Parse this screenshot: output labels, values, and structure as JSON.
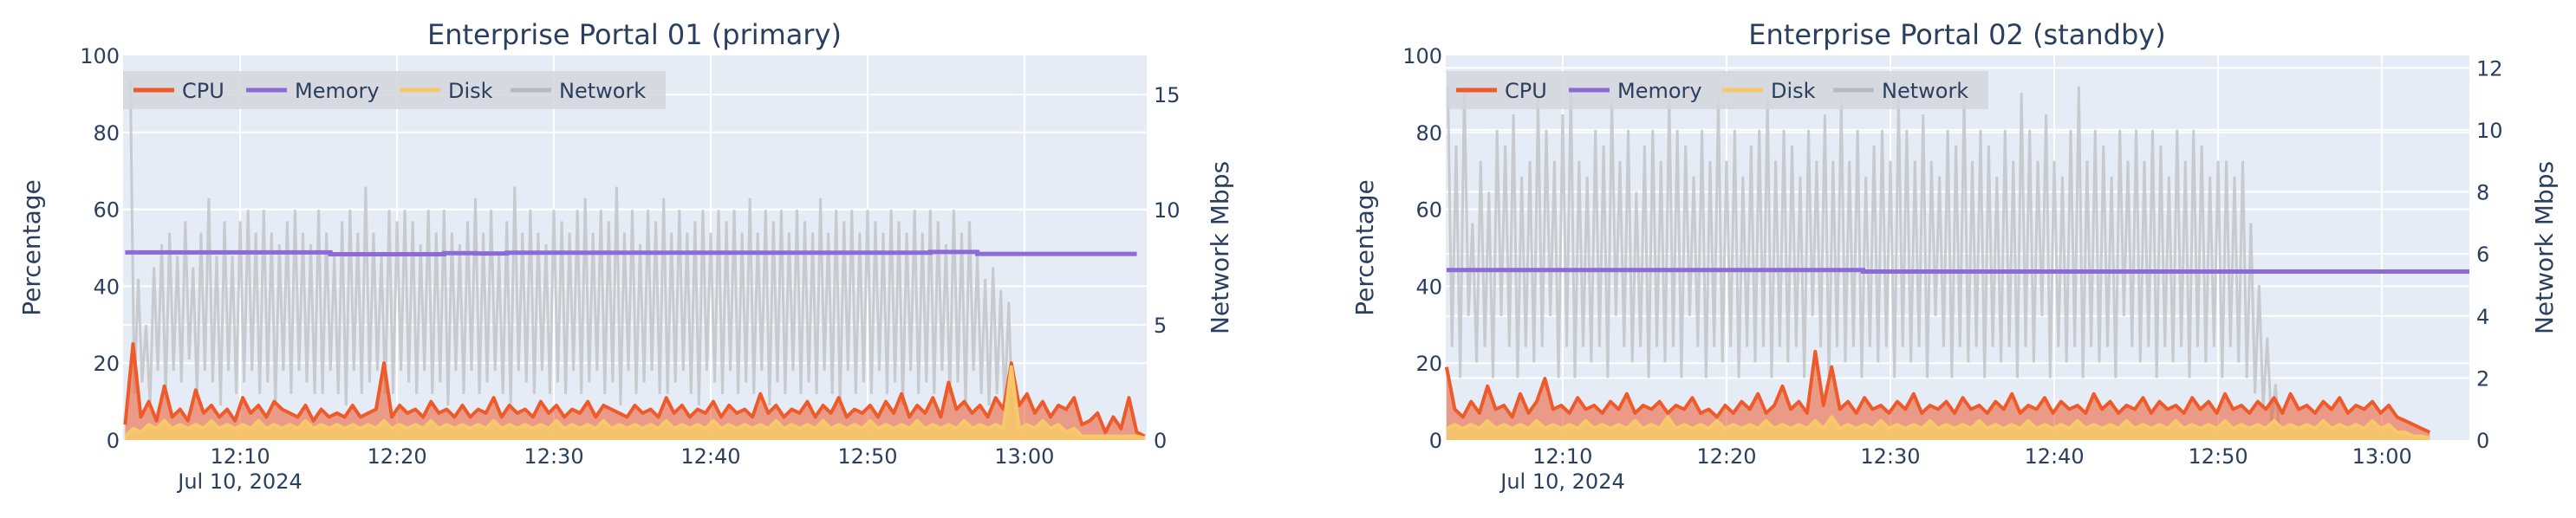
{
  "chart_data": [
    {
      "type": "line",
      "title": "Enterprise Portal 01 (primary)",
      "xlabel": "",
      "ylabel": "Percentage",
      "y2label": "Network Mbps",
      "date_label": "Jul 10, 2024",
      "x_range": [
        "12:02:32",
        "13:07:48"
      ],
      "x_ticks": [
        "12:10",
        "12:20",
        "12:30",
        "12:40",
        "12:50",
        "13:00"
      ],
      "ylim": [
        0,
        100
      ],
      "y_ticks": [
        0,
        20,
        40,
        60,
        80,
        100
      ],
      "y2lim": [
        0,
        16.7
      ],
      "y2_ticks": [
        0,
        5,
        10,
        15
      ],
      "grid": true,
      "legend": {
        "placement": "top-left",
        "orientation": "horizontal"
      },
      "series": [
        {
          "name": "CPU",
          "color": "#ef5a2b",
          "axis": "y",
          "fill": true,
          "start": "12:02:40",
          "step_seconds": 30,
          "values": [
            4,
            25,
            6,
            10,
            5,
            14,
            6,
            8,
            5,
            13,
            7,
            9,
            6,
            8,
            5,
            11,
            7,
            9,
            6,
            10,
            8,
            7,
            6,
            9,
            5,
            8,
            6,
            7,
            6,
            9,
            6,
            7,
            8,
            20,
            6,
            9,
            7,
            8,
            6,
            10,
            7,
            8,
            6,
            9,
            6,
            8,
            7,
            11,
            6,
            9,
            7,
            8,
            6,
            10,
            7,
            9,
            6,
            8,
            7,
            10,
            6,
            9,
            8,
            7,
            6,
            9,
            7,
            8,
            6,
            11,
            7,
            9,
            6,
            8,
            7,
            10,
            6,
            9,
            7,
            8,
            6,
            12,
            7,
            9,
            6,
            8,
            7,
            10,
            6,
            9,
            7,
            11,
            6,
            8,
            7,
            9,
            6,
            10,
            7,
            12,
            6,
            9,
            7,
            11,
            6,
            15,
            8,
            10,
            7,
            9,
            6,
            11,
            8,
            20,
            9,
            12,
            7,
            10,
            6,
            9,
            8,
            11,
            4,
            5,
            7,
            2,
            6,
            3,
            11,
            2,
            1
          ]
        },
        {
          "name": "Memory",
          "color": "#8c6bd8",
          "axis": "y",
          "fill": false,
          "steps": [
            [
              "12:02:40",
              48.8
            ],
            [
              "12:15:45",
              48.3
            ],
            [
              "12:23:00",
              48.6
            ],
            [
              "12:25:00",
              48.5
            ],
            [
              "12:27:00",
              48.7
            ],
            [
              "12:54:00",
              48.9
            ],
            [
              "12:57:00",
              48.4
            ],
            [
              "13:07:10",
              48.4
            ]
          ]
        },
        {
          "name": "Disk",
          "color": "#f7c96a",
          "axis": "y",
          "fill": true,
          "start": "12:02:40",
          "step_seconds": 30,
          "values": [
            1,
            3,
            2,
            4,
            3,
            5,
            3,
            4,
            3,
            4,
            3,
            5,
            3,
            4,
            3,
            4,
            3,
            5,
            3,
            4,
            3,
            4,
            3,
            5,
            3,
            4,
            3,
            4,
            3,
            4,
            3,
            4,
            3,
            5,
            3,
            4,
            3,
            4,
            3,
            5,
            3,
            4,
            3,
            4,
            3,
            4,
            3,
            5,
            3,
            4,
            3,
            4,
            3,
            4,
            3,
            5,
            3,
            4,
            3,
            4,
            3,
            5,
            3,
            4,
            3,
            4,
            3,
            4,
            3,
            5,
            3,
            4,
            3,
            4,
            3,
            5,
            3,
            4,
            3,
            4,
            3,
            4,
            3,
            5,
            3,
            4,
            3,
            4,
            3,
            5,
            3,
            4,
            3,
            4,
            3,
            5,
            3,
            4,
            3,
            4,
            3,
            5,
            3,
            4,
            3,
            4,
            3,
            5,
            3,
            4,
            3,
            4,
            3,
            19,
            3,
            4,
            3,
            5,
            3,
            4,
            2,
            3,
            1,
            1,
            1,
            1,
            1,
            1,
            1,
            1,
            0.5
          ]
        },
        {
          "name": "Network",
          "color": "#c4c6ca",
          "axis": "y2",
          "fill": false,
          "start": "12:03:00",
          "step_seconds": 15,
          "values": [
            15.6,
            2,
            7,
            2.5,
            5,
            1.5,
            7.5,
            3,
            8.5,
            2,
            9,
            3,
            8,
            2.5,
            9.5,
            3.5,
            7.5,
            2,
            9,
            3,
            10.5,
            2.5,
            8,
            1.5,
            9.5,
            3,
            8,
            2,
            9.5,
            2.5,
            10,
            3,
            9,
            2,
            10,
            2.5,
            9,
            1.5,
            8.5,
            3,
            9.5,
            2,
            10,
            3,
            9,
            2.5,
            8.5,
            2,
            10,
            2,
            9,
            3,
            8,
            2,
            9.5,
            1.5,
            10,
            3,
            9,
            2,
            11,
            2.5,
            9,
            3,
            8,
            2,
            10,
            2,
            9.5,
            3,
            10,
            2.5,
            9.5,
            2,
            8.5,
            3,
            10,
            2,
            9,
            2.5,
            10,
            1.5,
            9,
            3,
            8.5,
            2,
            9.5,
            3,
            10.5,
            2,
            9,
            2.5,
            10,
            3,
            8,
            2,
            9.5,
            1.5,
            11,
            3,
            9,
            2.5,
            10,
            2,
            9,
            3,
            8.5,
            2,
            10,
            2.5,
            9.5,
            2,
            9,
            3,
            10,
            2,
            10.5,
            2.5,
            9,
            3,
            10,
            2,
            9.5,
            2.5,
            11,
            1.5,
            9,
            3,
            10,
            2,
            8.5,
            2.5,
            10,
            3,
            9.5,
            2,
            10.5,
            2,
            9,
            2.5,
            10,
            3,
            9,
            2,
            9.5,
            1.5,
            10,
            3,
            9,
            2.5,
            10,
            2,
            9.5,
            3,
            10,
            2,
            9,
            2.5,
            10.5,
            2,
            9,
            3,
            10,
            1.5,
            9.5,
            2.5,
            10,
            2,
            9,
            3,
            10,
            2,
            9.5,
            2.5,
            9,
            2,
            10.5,
            3,
            9,
            2,
            10,
            1.5,
            9.5,
            3,
            10,
            2,
            9,
            2.5,
            10,
            2,
            9.5,
            3,
            9,
            2,
            10,
            2.5,
            9.5,
            1.5,
            9,
            3,
            10,
            2,
            9,
            2.5,
            10,
            2,
            9.5,
            3,
            8.5,
            2,
            10,
            2.5,
            9,
            1.5,
            9.5,
            3,
            8,
            2,
            7,
            1.5,
            7.5,
            2,
            6.5,
            1.5,
            6,
            0.5
          ]
        }
      ]
    },
    {
      "type": "line",
      "title": "Enterprise Portal 02 (standby)",
      "xlabel": "",
      "ylabel": "Percentage",
      "y2label": "Network Mbps",
      "date_label": "Jul 10, 2024",
      "x_range": [
        "12:02:52",
        "13:05:20"
      ],
      "x_ticks": [
        "12:10",
        "12:20",
        "12:30",
        "12:40",
        "12:50",
        "13:00"
      ],
      "ylim": [
        0,
        100
      ],
      "y_ticks": [
        0,
        20,
        40,
        60,
        80,
        100
      ],
      "y2lim": [
        0,
        12.4
      ],
      "y2_ticks": [
        0,
        2,
        4,
        6,
        8,
        10,
        12
      ],
      "grid": true,
      "legend": {
        "placement": "top-left",
        "orientation": "horizontal"
      },
      "series": [
        {
          "name": "CPU",
          "color": "#ef5a2b",
          "axis": "y",
          "fill": true,
          "start": "12:02:55",
          "step_seconds": 30,
          "values": [
            19,
            8,
            6,
            10,
            7,
            14,
            8,
            9,
            6,
            12,
            7,
            10,
            16,
            8,
            9,
            7,
            11,
            8,
            9,
            7,
            10,
            8,
            12,
            7,
            9,
            8,
            10,
            7,
            9,
            8,
            11,
            7,
            8,
            6,
            9,
            7,
            10,
            8,
            12,
            7,
            9,
            14,
            8,
            10,
            7,
            23,
            9,
            19,
            8,
            10,
            7,
            11,
            8,
            9,
            7,
            10,
            8,
            12,
            7,
            9,
            8,
            10,
            7,
            11,
            8,
            9,
            7,
            10,
            8,
            12,
            7,
            9,
            8,
            11,
            7,
            10,
            8,
            9,
            7,
            12,
            8,
            10,
            7,
            9,
            8,
            11,
            7,
            10,
            8,
            9,
            7,
            11,
            8,
            10,
            7,
            12,
            8,
            9,
            7,
            10,
            8,
            11,
            7,
            12,
            8,
            9,
            7,
            10,
            8,
            11,
            7,
            9,
            8,
            10,
            7,
            9,
            6,
            5,
            4,
            3,
            2
          ]
        },
        {
          "name": "Memory",
          "color": "#8c6bd8",
          "axis": "y",
          "fill": false,
          "steps": [
            [
              "12:02:55",
              44.2
            ],
            [
              "12:28:20",
              43.8
            ],
            [
              "13:05:20",
              43.8
            ]
          ]
        },
        {
          "name": "Disk",
          "color": "#f7c96a",
          "axis": "y",
          "fill": true,
          "start": "12:02:55",
          "step_seconds": 30,
          "values": [
            3,
            4,
            3,
            4,
            3,
            5,
            3,
            4,
            3,
            4,
            3,
            5,
            3,
            4,
            3,
            4,
            3,
            5,
            3,
            4,
            3,
            4,
            3,
            5,
            3,
            4,
            3,
            6,
            3,
            4,
            3,
            4,
            3,
            5,
            3,
            4,
            3,
            4,
            3,
            5,
            3,
            4,
            3,
            4,
            3,
            5,
            3,
            6,
            3,
            4,
            3,
            4,
            3,
            5,
            3,
            4,
            3,
            4,
            3,
            5,
            3,
            4,
            3,
            4,
            3,
            5,
            3,
            4,
            3,
            4,
            3,
            5,
            3,
            4,
            3,
            4,
            3,
            5,
            3,
            4,
            3,
            4,
            3,
            5,
            3,
            4,
            3,
            4,
            3,
            5,
            3,
            4,
            3,
            4,
            3,
            5,
            3,
            4,
            3,
            4,
            3,
            5,
            3,
            4,
            3,
            4,
            3,
            5,
            3,
            4,
            3,
            4,
            3,
            5,
            3,
            4,
            2,
            2,
            1,
            1,
            0.5
          ]
        },
        {
          "name": "Network",
          "color": "#c4c6ca",
          "axis": "y2",
          "fill": false,
          "start": "12:03:00",
          "step_seconds": 15,
          "values": [
            11.4,
            3,
            9.5,
            2,
            11.4,
            4,
            7,
            2.5,
            9,
            3,
            8,
            2,
            10,
            4,
            9.5,
            3,
            10.5,
            2,
            8.5,
            3,
            9,
            2.5,
            11,
            3,
            10,
            4,
            9,
            2,
            10.5,
            3,
            11.4,
            2,
            9,
            3,
            8.5,
            2.5,
            10,
            3,
            9.5,
            2,
            11,
            4,
            9,
            3,
            10,
            2.5,
            8,
            3,
            9.5,
            2,
            10,
            3,
            9,
            2.5,
            11,
            3,
            10,
            2,
            9.5,
            4,
            8.5,
            3,
            10,
            2,
            9,
            3,
            11,
            2.5,
            9,
            3,
            10,
            2,
            8.5,
            3,
            9.5,
            2.5,
            10,
            3,
            11,
            2,
            9,
            3,
            10,
            2.5,
            9.5,
            3,
            8.5,
            2,
            10,
            4,
            9,
            3,
            10.5,
            2,
            9,
            3,
            11,
            2.5,
            9,
            3,
            10,
            2,
            8.5,
            3,
            9.5,
            2.5,
            10,
            3,
            9,
            2,
            11,
            3,
            10,
            2.5,
            9,
            3,
            10.5,
            2,
            9,
            4,
            8.5,
            3,
            10,
            2,
            9.5,
            3,
            11,
            2.5,
            9,
            3,
            10,
            2,
            9.5,
            3,
            8.5,
            2.5,
            10,
            3,
            9,
            2,
            11.2,
            3,
            10,
            2.5,
            9,
            4,
            10.5,
            2,
            9,
            3,
            8.5,
            2.5,
            10,
            3,
            11.4,
            2,
            9,
            3,
            10,
            2.5,
            9.5,
            3,
            8.5,
            2,
            10,
            4,
            9,
            3,
            10,
            2.5,
            9,
            3,
            10,
            2,
            9.5,
            3,
            8.5,
            2.5,
            10,
            3,
            9,
            2,
            10,
            3,
            9.5,
            2.5,
            8.5,
            3,
            9,
            2,
            9,
            3,
            8.5,
            2.5,
            9,
            2,
            7,
            1.5,
            5,
            1,
            3.3,
            0.5,
            1.8,
            0.2
          ]
        }
      ]
    }
  ]
}
